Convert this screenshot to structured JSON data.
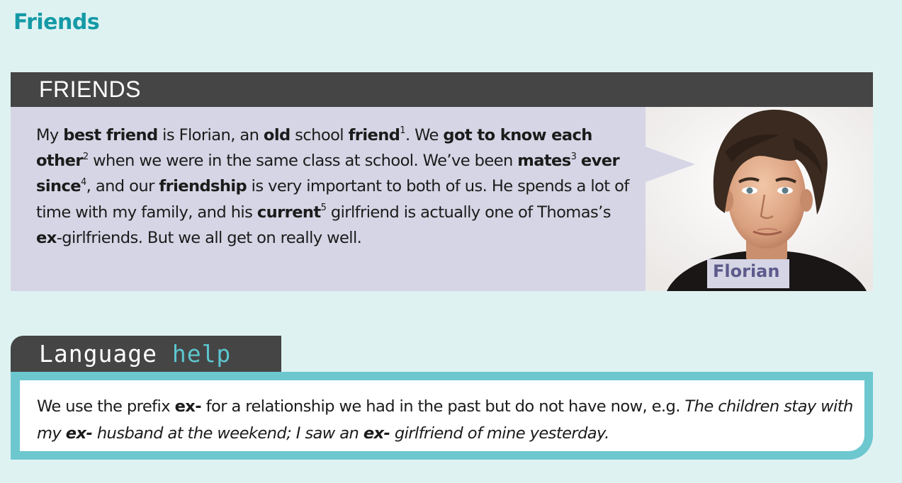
{
  "page": {
    "title": "Friends"
  },
  "panel": {
    "header": "FRIENDS",
    "photo_label": "Florian",
    "paragraph": [
      {
        "t": "My "
      },
      {
        "t": "best friend",
        "b": true
      },
      {
        "t": " is Florian, an "
      },
      {
        "t": "old",
        "b": true
      },
      {
        "t": " school "
      },
      {
        "t": "friend",
        "b": true
      },
      {
        "t": "1",
        "sup": true
      },
      {
        "t": ". We "
      },
      {
        "t": "got to know each other",
        "b": true
      },
      {
        "t": "2",
        "sup": true
      },
      {
        "t": " when we were in the same class at school. We’ve been "
      },
      {
        "t": "mates",
        "b": true
      },
      {
        "t": "3",
        "sup": true
      },
      {
        "t": " "
      },
      {
        "t": "ever since",
        "b": true
      },
      {
        "t": "4",
        "sup": true
      },
      {
        "t": ", and our "
      },
      {
        "t": "friendship",
        "b": true
      },
      {
        "t": " is very important to both of us. He spends a lot of time with my family, and his "
      },
      {
        "t": "current",
        "b": true
      },
      {
        "t": "5",
        "sup": true
      },
      {
        "t": " girlfriend is actually one of Thomas’s "
      },
      {
        "t": "ex",
        "b": true
      },
      {
        "t": "-girlfriends. But we all get on really well."
      }
    ]
  },
  "language_help": {
    "title_word1": "Language",
    "title_word2": "help",
    "text": [
      {
        "t": "We use the prefix "
      },
      {
        "t": "ex-",
        "b": true
      },
      {
        "t": " for a relationship we had in the past but do not have now, e.g. "
      },
      {
        "t": "The children stay with my ",
        "i": true
      },
      {
        "t": "ex-",
        "b": true,
        "i": true
      },
      {
        "t": " husband at the weekend; I saw an ",
        "i": true
      },
      {
        "t": "ex-",
        "b": true,
        "i": true
      },
      {
        "t": " girlfriend of mine yesterday.",
        "i": true
      }
    ]
  },
  "colors": {
    "background": "#dff2f2",
    "title_teal": "#149aa6",
    "header_dark": "#454545",
    "panel_lilac": "#d5d5e5",
    "label_purple": "#5e5a8c",
    "help_teal": "#6cc7cf",
    "help_accent": "#5cc6cf"
  },
  "icons": {
    "photo": "portrait-photo"
  }
}
